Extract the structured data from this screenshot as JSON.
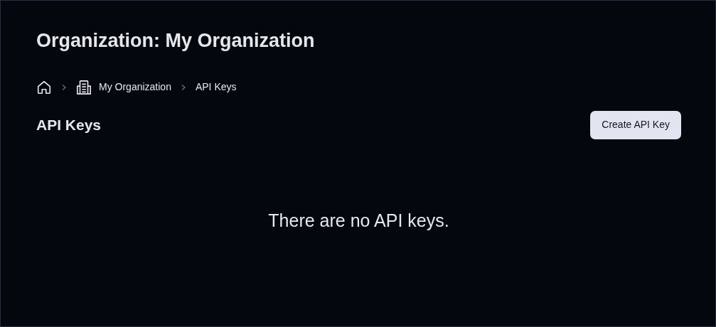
{
  "page_title": "Organization: My Organization",
  "breadcrumb": [
    {
      "kind": "home"
    },
    {
      "kind": "org",
      "label": "My Organization"
    },
    {
      "kind": "text",
      "label": "API Keys"
    }
  ],
  "section": {
    "title": "API Keys",
    "button": "Create API Key"
  },
  "empty_message": "There are no API keys."
}
